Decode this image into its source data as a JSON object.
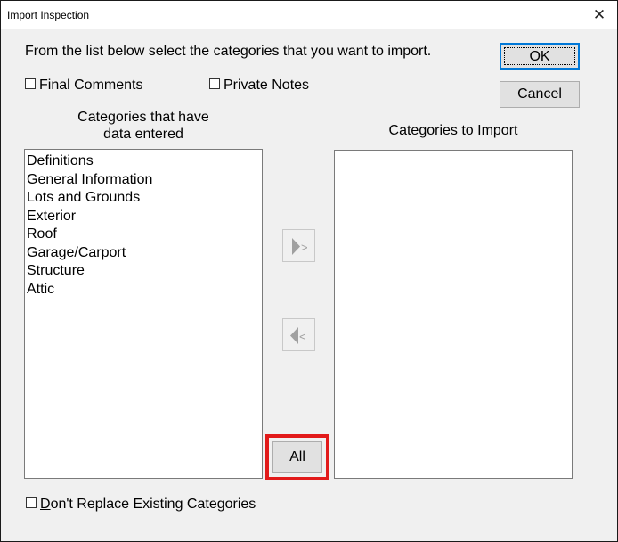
{
  "window": {
    "title": "Import Inspection",
    "close_glyph": "✕"
  },
  "instruction": "From the list below select the categories that you want to import.",
  "checkboxes": {
    "final_comments": {
      "label": "Final Comments",
      "checked": false
    },
    "private_notes": {
      "label": "Private Notes",
      "checked": false
    }
  },
  "buttons": {
    "ok": "OK",
    "cancel": "Cancel",
    "all": "All",
    "add_glyph": ">",
    "remove_glyph": "<"
  },
  "left_list": {
    "header_line1": "Categories that have",
    "header_line2": "data entered",
    "items": [
      "Definitions",
      "General Information",
      "Lots and Grounds",
      "Exterior",
      "Roof",
      "Garage/Carport",
      "Structure",
      "Attic"
    ]
  },
  "right_list": {
    "header": "Categories to Import",
    "items": []
  },
  "dont_replace": {
    "underlined_char": "D",
    "label_rest": "on't Replace Existing Categories",
    "checked": false
  },
  "colors": {
    "highlight": "#e21a1a",
    "focus": "#0078d7"
  }
}
